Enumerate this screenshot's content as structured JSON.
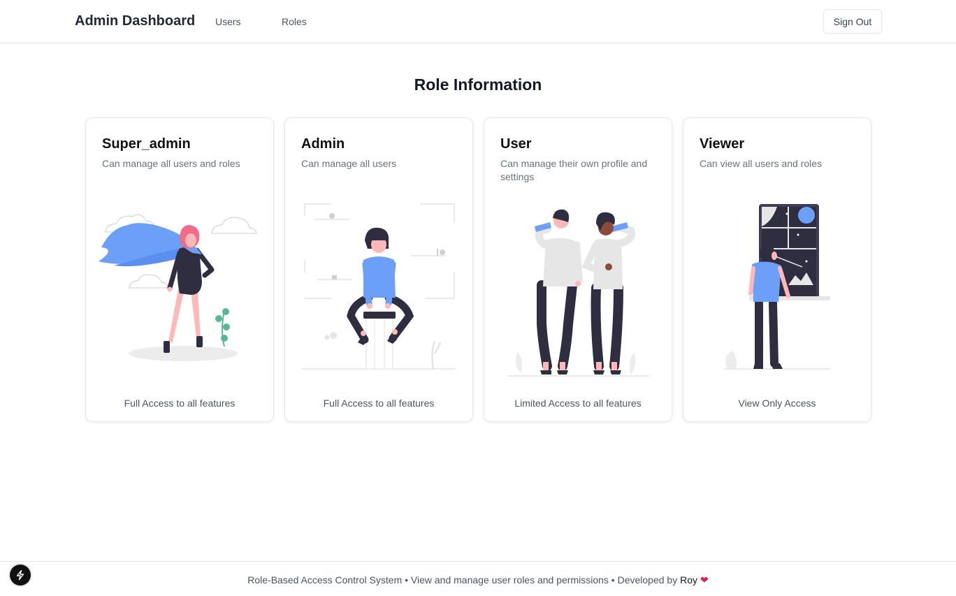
{
  "nav": {
    "brand": "Admin Dashboard",
    "links": [
      "Users",
      "Roles"
    ],
    "signout_label": "Sign Out"
  },
  "page_title": "Role Information",
  "roles": [
    {
      "title": "Super_admin",
      "description": "Can manage all users and roles",
      "access": "Full Access to all features",
      "illustration": "superhero-woman-illustration"
    },
    {
      "title": "Admin",
      "description": "Can manage all users",
      "access": "Full Access to all features",
      "illustration": "woman-on-stool-illustration"
    },
    {
      "title": "User",
      "description": "Can manage their own profile and settings",
      "access": "Limited Access to all features",
      "illustration": "two-people-drinking-illustration"
    },
    {
      "title": "Viewer",
      "description": "Can view all users and roles",
      "access": "View Only Access",
      "illustration": "man-at-window-illustration"
    }
  ],
  "footer": {
    "text": "Role-Based Access Control System • View and manage user roles and permissions • Developed by ",
    "developer": "Roy",
    "heart": "❤"
  },
  "colors": {
    "accent_blue": "#6c9ff7",
    "dark": "#2f2e41",
    "pink": "#ffb8b8",
    "hair_pink": "#f06a8a",
    "green": "#57b894",
    "gray": "#e6e6e6",
    "heart": "#e11d48"
  }
}
